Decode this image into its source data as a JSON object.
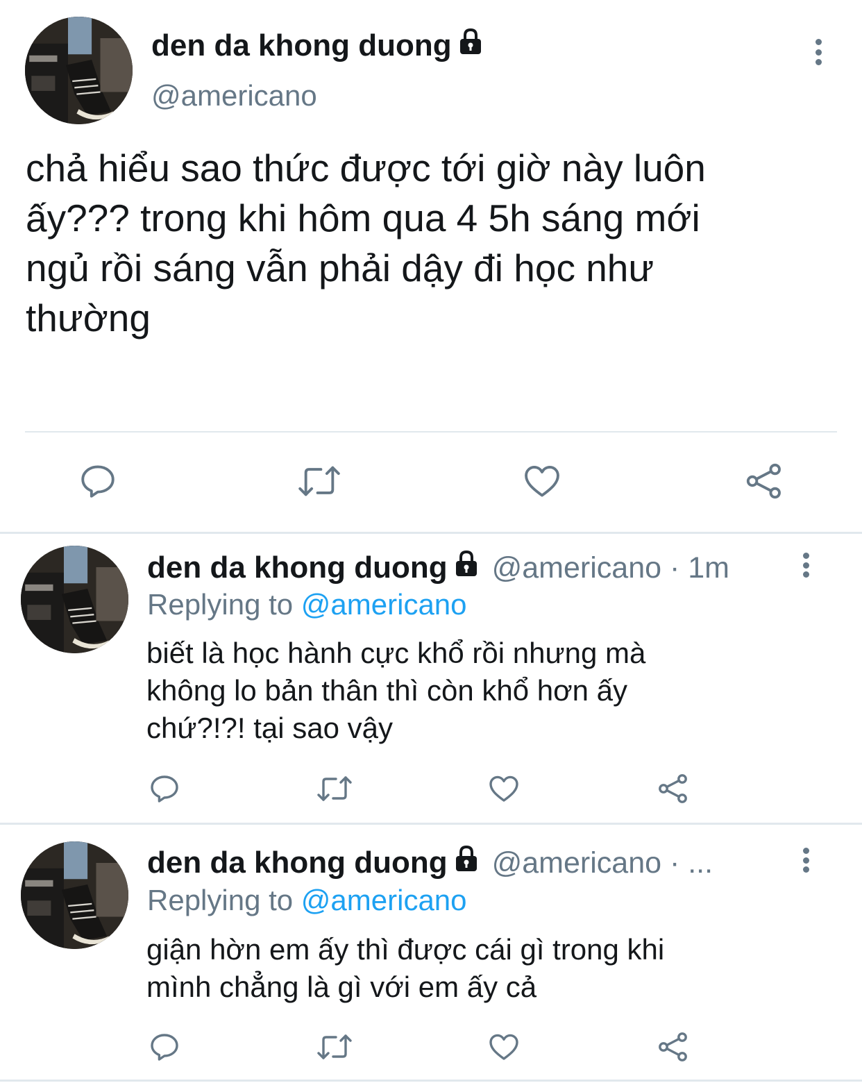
{
  "main_tweet": {
    "author_name": "den da khong duong",
    "handle": "@americano",
    "text_lines": [
      "chả hiểu sao thức được tới giờ này luôn",
      "ấy??? trong khi hôm qua 4 5h sáng mới",
      "ngủ rồi sáng vẫn phải dậy đi học như",
      "thường"
    ],
    "icons": [
      "lock-icon",
      "more-vertical-icon",
      "reply-icon",
      "retweet-icon",
      "like-icon",
      "share-icon"
    ]
  },
  "replies": [
    {
      "author_name": "den da khong duong",
      "handle_time": "@americano · 1m",
      "replying_prefix": "Replying to",
      "replying_handle": "@americano",
      "text_lines": [
        "biết là học hành cực khổ rồi nhưng mà",
        "không lo bản thân thì còn khổ hơn ấy",
        "chứ?!?! tại sao vậy"
      ]
    },
    {
      "author_name": "den da khong duong",
      "handle_time": "@americano · ...",
      "replying_prefix": "Replying to",
      "replying_handle": "@americano",
      "text_lines": [
        "giận hờn em ấy thì được cái gì trong khi",
        "mình chẳng là gì với em ấy cả"
      ]
    }
  ],
  "colors": {
    "text": "#14171a",
    "secondary": "#657786",
    "link": "#1da1f2",
    "divider": "#e1e8ed"
  }
}
